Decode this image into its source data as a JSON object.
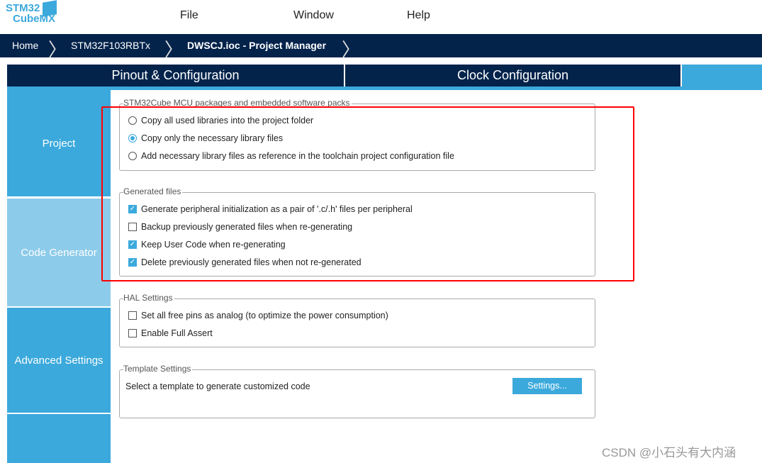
{
  "logo": {
    "line1": "STM32",
    "line2": "CubeMX"
  },
  "menu": [
    "File",
    "Window",
    "Help"
  ],
  "breadcrumb": [
    "Home",
    "STM32F103RBTx",
    "DWSCJ.ioc - Project Manager"
  ],
  "tabs": [
    "Pinout & Configuration",
    "Clock Configuration"
  ],
  "sidebar": [
    {
      "label": "Project"
    },
    {
      "label": "Code Generator",
      "active": true
    },
    {
      "label": "Advanced Settings"
    }
  ],
  "packages": {
    "title": "STM32Cube MCU packages and embedded software packs",
    "options": [
      "Copy all used libraries into the project folder",
      "Copy only the necessary library files",
      "Add necessary library files as reference in the toolchain project configuration file"
    ],
    "selected": 1
  },
  "generated": {
    "title": "Generated files",
    "options": [
      {
        "label": "Generate peripheral initialization as a pair of '.c/.h' files per peripheral",
        "checked": true
      },
      {
        "label": "Backup previously generated files when re-generating",
        "checked": false
      },
      {
        "label": "Keep User Code when re-generating",
        "checked": true
      },
      {
        "label": "Delete previously generated files when not re-generated",
        "checked": true
      }
    ]
  },
  "hal": {
    "title": "HAL Settings",
    "options": [
      {
        "label": "Set all free pins as analog (to optimize the power consumption)",
        "checked": false
      },
      {
        "label": "Enable Full Assert",
        "checked": false
      }
    ]
  },
  "template": {
    "title": "Template Settings",
    "text": "Select a template to generate customized code",
    "button": "Settings..."
  },
  "watermark": "CSDN @小石头有大内涵",
  "colors": {
    "navy": "#03234b",
    "accent": "#3ba9dc",
    "highlight": "#ff0000"
  }
}
